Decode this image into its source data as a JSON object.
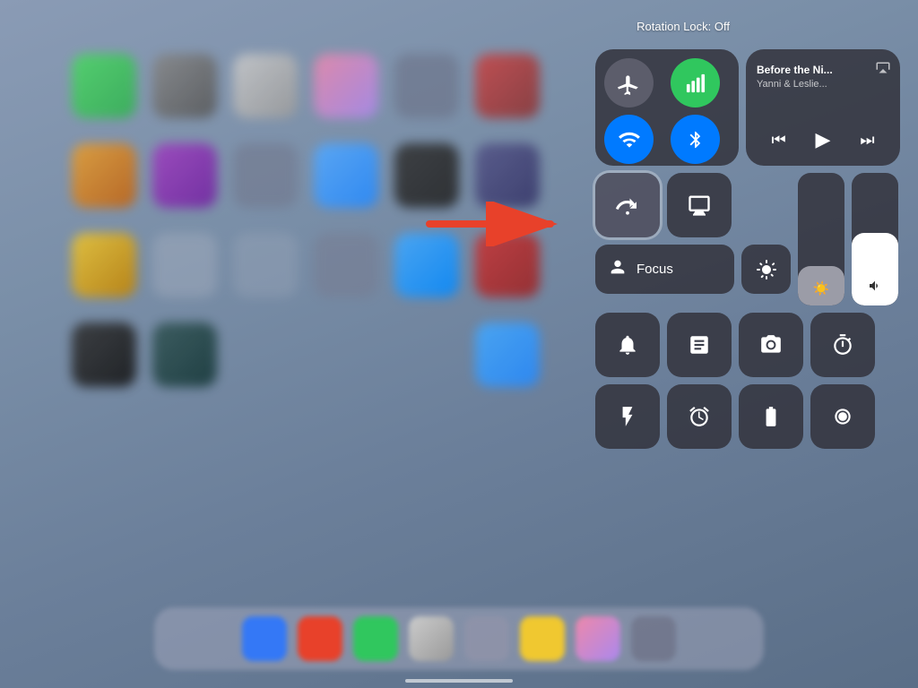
{
  "background": {
    "colors": [
      "#8a9bb5",
      "#7a8fa8",
      "#6b7f9a",
      "#5a6e87"
    ]
  },
  "rotation_lock_label": "Rotation Lock: Off",
  "control_center": {
    "connectivity": {
      "airplane_mode": {
        "label": "Airplane Mode",
        "active": false,
        "color": "#666677"
      },
      "cellular": {
        "label": "Cellular",
        "active": true,
        "color": "#30c75e"
      },
      "wifi": {
        "label": "Wi-Fi",
        "active": true,
        "color": "#007aff"
      },
      "bluetooth": {
        "label": "Bluetooth",
        "active": true,
        "color": "#007aff"
      }
    },
    "now_playing": {
      "title": "Before the Ni...",
      "artist": "Yanni & Leslie...",
      "airplay_icon": "airplay"
    },
    "rotation_lock": {
      "label": "Rotation Lock",
      "active": true
    },
    "screen_mirror": {
      "label": "Screen Mirror"
    },
    "brightness": {
      "level": 0.3,
      "icon": "☀"
    },
    "volume": {
      "level": 0.55,
      "icon": "🔊"
    },
    "focus": {
      "label": "Focus",
      "icon": "person"
    },
    "buttons_row1": [
      {
        "id": "mute",
        "icon": "🔔"
      },
      {
        "id": "notes",
        "icon": "📋"
      },
      {
        "id": "camera",
        "icon": "📷"
      },
      {
        "id": "timer",
        "icon": "⏱"
      }
    ],
    "buttons_row2": [
      {
        "id": "flashlight",
        "icon": "🔦"
      },
      {
        "id": "alarm",
        "icon": "⏰"
      },
      {
        "id": "battery",
        "icon": "🔋"
      },
      {
        "id": "record",
        "icon": "⏺"
      }
    ]
  },
  "arrow": {
    "color": "#e8412a"
  },
  "dock": {
    "icon_colors": [
      "#3478f6",
      "#e8412a",
      "#30c75e",
      "#f0f0f0",
      "#f0f0f0",
      "#f0c830",
      "#e8412a",
      "#aaaaaa"
    ]
  }
}
